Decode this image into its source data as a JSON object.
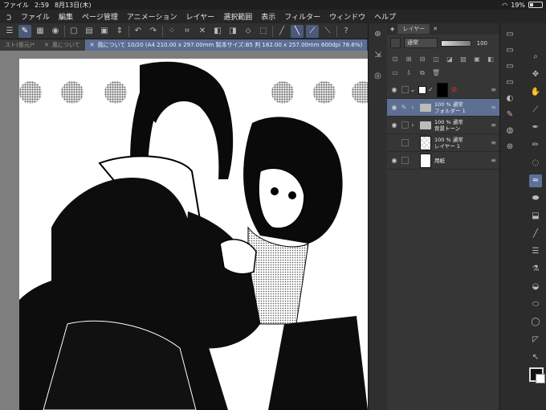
{
  "status": {
    "app": "ファイル",
    "time": "2:59",
    "date": "8月13日(木)",
    "battery": "19%"
  },
  "menu": [
    "ファイル",
    "編集",
    "ページ管理",
    "アニメーション",
    "レイヤー",
    "選択範囲",
    "表示",
    "フィルター",
    "ウィンドウ",
    "ヘルプ"
  ],
  "tabs": [
    {
      "label": "スト(復元)*",
      "active": false
    },
    {
      "label": "風について",
      "active": false
    },
    {
      "label": "風について 10/20 (A4 210.00 x 297.00mm 製本サイズ:B5 判 182.00 x 257.00mm 600dpi 78.6%)",
      "active": true
    }
  ],
  "layer_panel": {
    "tab_label": "レイヤー",
    "blend_mode": "通常",
    "opacity": "100",
    "layers": [
      {
        "line1": "",
        "line2": "",
        "type": "mask",
        "selected": false
      },
      {
        "line1": "100 % 通常",
        "line2": "フォルダー 1",
        "type": "folder",
        "selected": true
      },
      {
        "line1": "100 % 通常",
        "line2": "背景トーン",
        "type": "folder",
        "selected": false
      },
      {
        "line1": "100 % 通常",
        "line2": "レイヤー 1",
        "type": "raster",
        "selected": false
      },
      {
        "line1": "",
        "line2": "用紙",
        "type": "paper",
        "selected": false
      }
    ]
  },
  "colors": {
    "accent": "#5d6f92",
    "main_color": "#111111",
    "sub_color": "#ffffff"
  }
}
